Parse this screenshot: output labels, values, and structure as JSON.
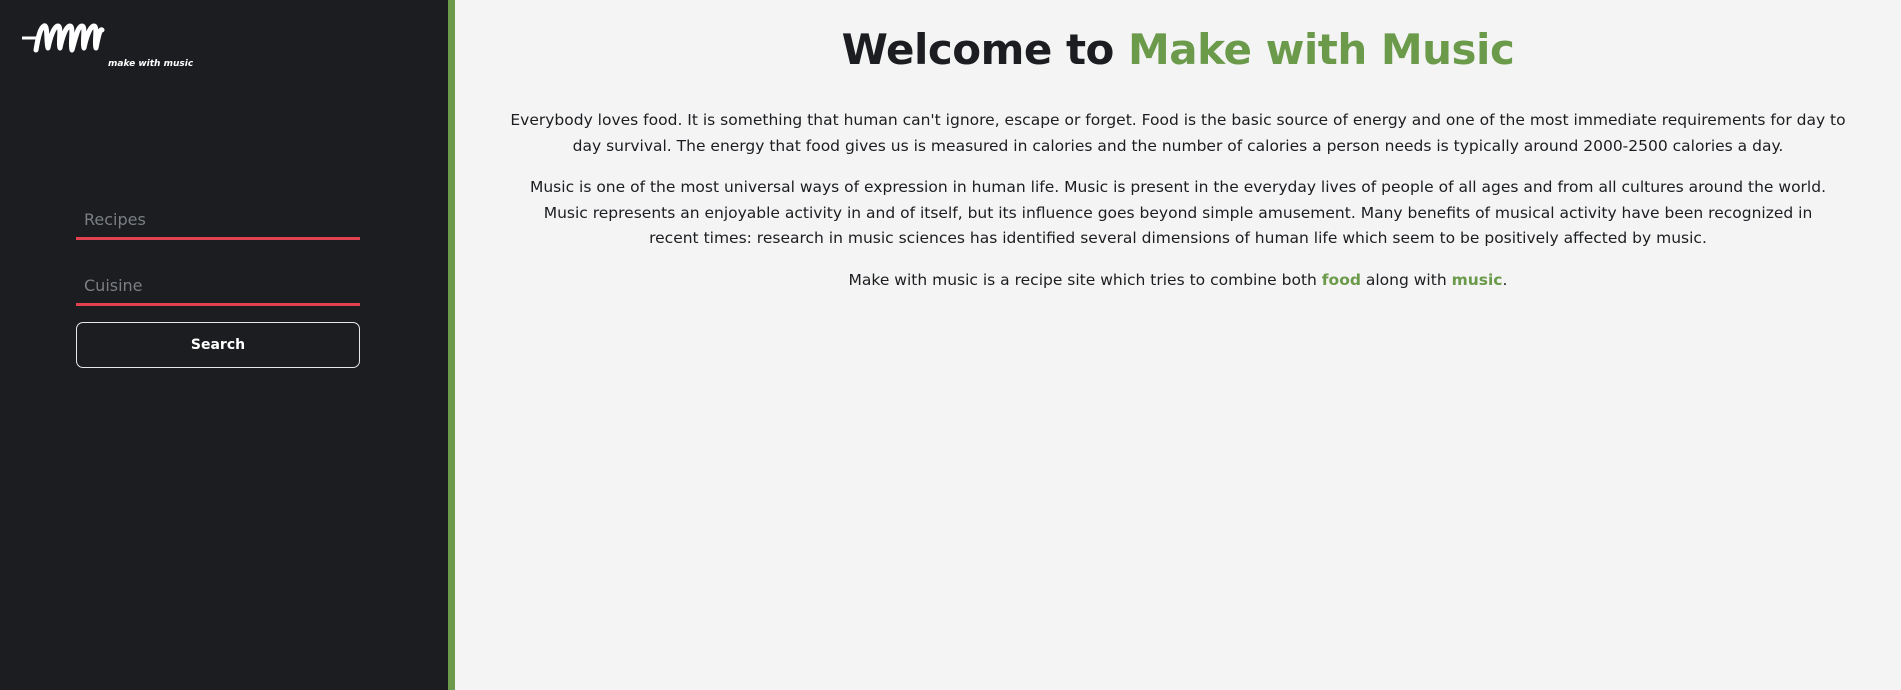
{
  "sidebar": {
    "logo_text": "mm",
    "logo_tagline": "make with music",
    "recipes_placeholder": "Recipes",
    "cuisine_placeholder": "Cuisine",
    "search_label": "Search"
  },
  "main": {
    "title_prefix": "Welcome to",
    "title_accent": "Make with Music",
    "paragraph1": "Everybody loves food. It is something that human can't ignore, escape or forget. Food is the basic source of energy and one of the most immediate requirements for day to day survival. The energy that food gives us is measured in calories and the number of calories a person needs is typically around 2000-2500 calories a day.",
    "paragraph2": "Music is one of the most universal ways of expression in human life. Music is present in the everyday lives of people of all ages and from all cultures around the world. Music represents an enjoyable activity in and of itself, but its influence goes beyond simple amusement. Many benefits of musical activity have been recognized in recent times: research in music sciences has identified several dimensions of human life which seem to be positively affected by music.",
    "paragraph3_start": "Make with music is a recipe site which tries to combine both",
    "paragraph3_food": "food",
    "paragraph3_middle": "along with",
    "paragraph3_music": "music",
    "paragraph3_end": "."
  },
  "colors": {
    "accent": "#6a9a4a",
    "sidebar_bg": "#1b1d20",
    "input_underline": "#e2424f",
    "page_bg": "#f4f4f4"
  }
}
